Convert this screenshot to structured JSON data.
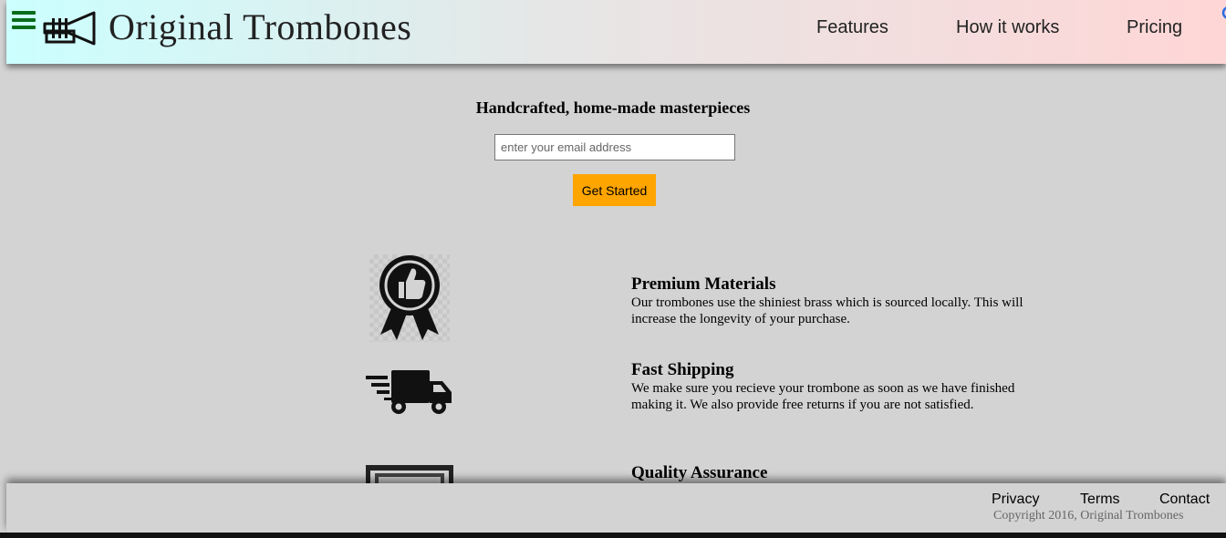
{
  "header": {
    "brand": "Original Trombones",
    "nav": [
      "Features",
      "How it works",
      "Pricing"
    ]
  },
  "hero": {
    "tagline": "Handcrafted, home-made masterpieces",
    "email_placeholder": "enter your email address",
    "cta_label": "Get Started"
  },
  "features": [
    {
      "icon": "ribbon-thumbs-up-icon",
      "title": "Premium Materials",
      "description": "Our trombones use the shiniest brass which is sourced locally. This will increase the longevity of your purchase."
    },
    {
      "icon": "delivery-truck-icon",
      "title": "Fast Shipping",
      "description": "We make sure you recieve your trombone as soon as we have finished making it. We also provide free returns if you are not satisfied."
    },
    {
      "icon": "quality-assurance-icon",
      "title": "Quality Assurance",
      "description": ""
    }
  ],
  "footer": {
    "links": [
      "Privacy",
      "Terms",
      "Contact"
    ],
    "copyright": "Copyright 2016, Original Trombones"
  },
  "colors": {
    "background": "#d3d3d3",
    "cta": "#ffa500",
    "menu_icon": "#0a6b1a",
    "header_gradient_start": "#ccffff",
    "header_gradient_end": "#ffd6d6"
  }
}
